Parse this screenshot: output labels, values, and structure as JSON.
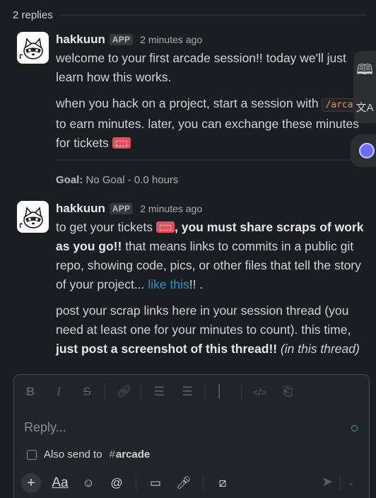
{
  "thread": {
    "replies_label": "2 replies"
  },
  "messages": [
    {
      "author": "hakkuun",
      "badge": "APP",
      "time": "2 minutes ago",
      "p1": "welcome to your first arcade session!! today we'll just learn how this works.",
      "p2_a": "when you hack on a project, start a session with ",
      "p2_code": "/arcade",
      "p2_b": " to earn minutes. later, you can exchange these minutes for tickets "
    },
    {
      "author": "hakkuun",
      "badge": "APP",
      "time": "2 minutes ago",
      "p1_a": "to get your tickets ",
      "p1_bold": ", you must share scraps of work as you go!!",
      "p1_b": " that means links to commits in a public git repo, showing code, pics, or other files that tell the story of your project... ",
      "p1_link": "like this",
      "p1_end": "!! .",
      "p2_a": "post your scrap links here in your session thread (you need at least one for your minutes to count). this time, ",
      "p2_bold": "just post a screenshot of this thread!!",
      "p2_italic": " (in this thread)"
    }
  ],
  "goal": {
    "label": "Goal:",
    "value": " No Goal - 0.0 hours"
  },
  "side_tools": {
    "reader_icon": "book-icon",
    "translate_icon": "translate-icon"
  },
  "composer": {
    "placeholder": "Reply...",
    "also_send_label": "Also send to",
    "channel": "arcade",
    "format_icons": [
      "bold-icon",
      "italic-icon",
      "strikethrough-icon",
      "link-icon",
      "ordered-list-icon",
      "bulleted-list-icon",
      "quote-icon",
      "code-icon",
      "code-block-icon"
    ],
    "tool_icons": [
      "plus-icon",
      "text-format-icon",
      "emoji-icon",
      "mention-icon",
      "video-icon",
      "microphone-icon",
      "slash-command-icon",
      "send-icon"
    ]
  }
}
